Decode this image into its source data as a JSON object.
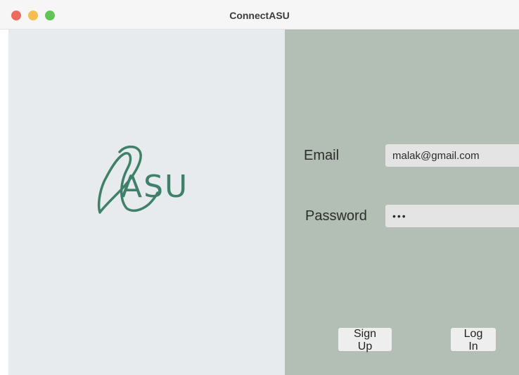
{
  "window": {
    "title": "ConnectASU"
  },
  "logo": {
    "text": "ASU",
    "color": "#3f8069"
  },
  "form": {
    "email_label": "Email",
    "email_value": "malak@gmail.com",
    "password_label": "Password",
    "password_value": "abc"
  },
  "actions": {
    "signup_label": "Sign Up",
    "login_label": "Log In"
  },
  "colors": {
    "left_pane": "#e7ebed",
    "right_pane": "#b3beb5",
    "field_bg": "#e4e4e4"
  },
  "icons": {
    "close": "close-dot",
    "minimize": "minimize-dot",
    "maximize": "maximize-dot"
  }
}
